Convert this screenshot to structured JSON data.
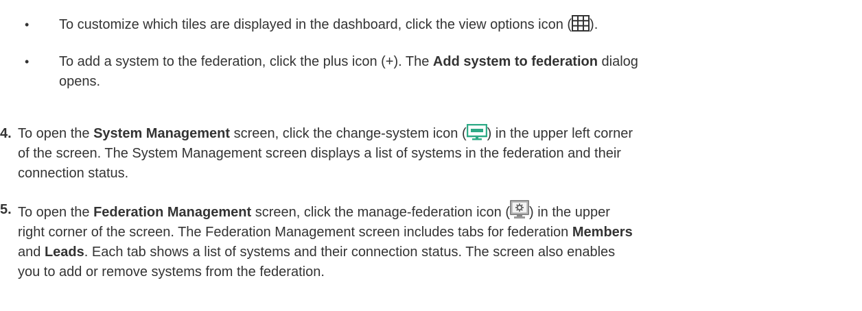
{
  "bullets": [
    {
      "dot": "•",
      "before": "To customize which tiles are displayed in the dashboard, click the view options icon (",
      "icon": "grid-view-icon",
      "after": ")."
    },
    {
      "dot": "•",
      "before": "To add a system to the federation, click the plus icon (+). The ",
      "bold": "Add system to federation",
      "after_line1": " dialog",
      "line2": "opens."
    }
  ],
  "steps": [
    {
      "number": "4.",
      "l1_before": "To open the ",
      "l1_bold": "System Management",
      "l1_mid": " screen, click the change-system icon (",
      "icon": "monitor-icon",
      "l1_after": ") in the upper left corner",
      "line2": "of the screen. The System Management screen displays a list of systems in the federation and their",
      "line3": "connection status."
    },
    {
      "number": "5.",
      "l1_before": "To open the ",
      "l1_bold": "Federation Management",
      "l1_mid": " screen, click the manage-federation icon (",
      "icon": "manage-federation-icon",
      "l1_after": ") in the upper",
      "l2_before": "right corner of the screen. The Federation Management screen includes tabs for federation ",
      "l2_bold": "Members",
      "l3_bold_pre": "and ",
      "l3_bold": "Leads",
      "l3_after": ". Each tab shows a list of systems and their connection status. The screen also enables",
      "line4": "you to add or remove systems from the federation."
    }
  ],
  "colors": {
    "text": "#333333",
    "monitor_green": "#2eaa86",
    "icon_gray": "#666666"
  }
}
